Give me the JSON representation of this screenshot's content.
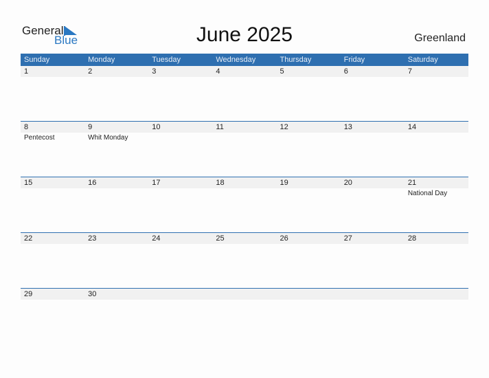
{
  "logo": {
    "general": "General",
    "blue": "Blue"
  },
  "title": "June 2025",
  "country": "Greenland",
  "weekdays": [
    "Sunday",
    "Monday",
    "Tuesday",
    "Wednesday",
    "Thursday",
    "Friday",
    "Saturday"
  ],
  "weeks": [
    [
      {
        "n": "1"
      },
      {
        "n": "2"
      },
      {
        "n": "3"
      },
      {
        "n": "4"
      },
      {
        "n": "5"
      },
      {
        "n": "6"
      },
      {
        "n": "7"
      }
    ],
    [
      {
        "n": "8",
        "h": "Pentecost"
      },
      {
        "n": "9",
        "h": "Whit Monday"
      },
      {
        "n": "10"
      },
      {
        "n": "11"
      },
      {
        "n": "12"
      },
      {
        "n": "13"
      },
      {
        "n": "14"
      }
    ],
    [
      {
        "n": "15"
      },
      {
        "n": "16"
      },
      {
        "n": "17"
      },
      {
        "n": "18"
      },
      {
        "n": "19"
      },
      {
        "n": "20"
      },
      {
        "n": "21",
        "h": "National Day"
      }
    ],
    [
      {
        "n": "22"
      },
      {
        "n": "23"
      },
      {
        "n": "24"
      },
      {
        "n": "25"
      },
      {
        "n": "26"
      },
      {
        "n": "27"
      },
      {
        "n": "28"
      }
    ],
    [
      {
        "n": "29"
      },
      {
        "n": "30"
      },
      {
        "n": ""
      },
      {
        "n": ""
      },
      {
        "n": ""
      },
      {
        "n": ""
      },
      {
        "n": ""
      }
    ]
  ]
}
